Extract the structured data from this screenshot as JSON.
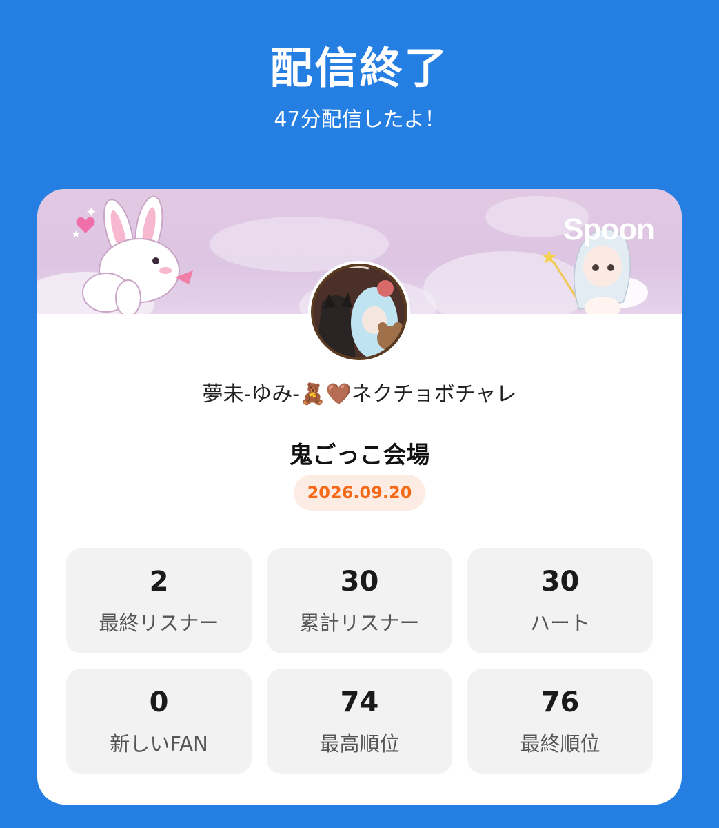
{
  "header": {
    "title": "配信終了",
    "subtitle": "47分配信したよ！"
  },
  "card": {
    "brand": "Spoon",
    "username": "夢未-ゆみ-🧸🤎ネクチョボチャレ",
    "live_title": "鬼ごっこ会場",
    "date": "2026.09.20",
    "stats": [
      {
        "value": "2",
        "label": "最終リスナー"
      },
      {
        "value": "30",
        "label": "累計リスナー"
      },
      {
        "value": "30",
        "label": "ハート"
      },
      {
        "value": "0",
        "label": "新しいFAN"
      },
      {
        "value": "74",
        "label": "最高順位"
      },
      {
        "value": "76",
        "label": "最終順位"
      }
    ]
  },
  "colors": {
    "background": "#257fe3",
    "date_text": "#f56a18",
    "date_bg": "#fdece4",
    "stat_bg": "#f2f2f2"
  }
}
